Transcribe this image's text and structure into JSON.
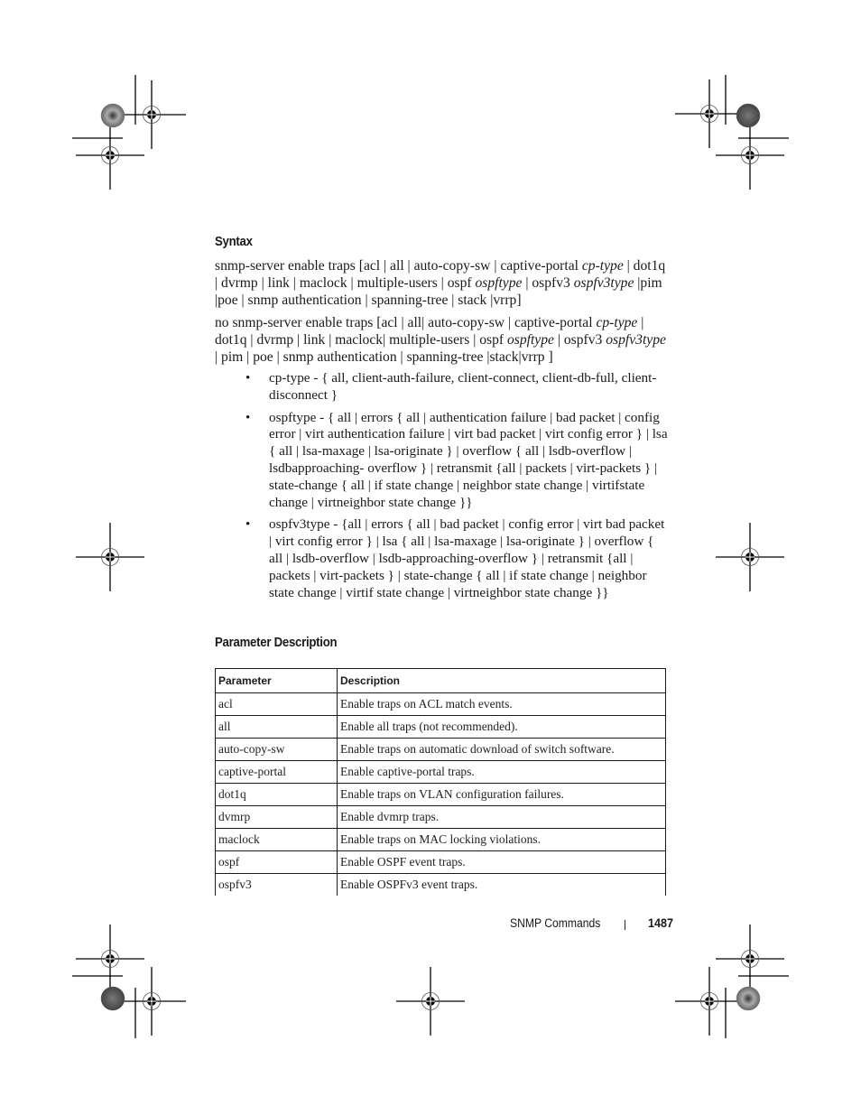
{
  "sections": {
    "syntax_heading": "Syntax",
    "parameter_heading": "Parameter Description"
  },
  "syntax": {
    "command": [
      {
        "text": "snmp-server enable traps [acl | all | auto-copy-sw | captive-portal ",
        "italic": false
      },
      {
        "text": "cp-type",
        "italic": true
      },
      {
        "text": " | dot1q | dvrmp | link | maclock | multiple-users | ospf ",
        "italic": false
      },
      {
        "text": "ospftype",
        "italic": true
      },
      {
        "text": " | ospfv3 ",
        "italic": false
      },
      {
        "text": "ospfv3type",
        "italic": true
      },
      {
        "text": " |pim |poe | snmp authentication | spanning-tree | stack |vrrp]",
        "italic": false
      }
    ],
    "no_command": [
      {
        "text": "no snmp-server enable traps [acl | all| auto-copy-sw | captive-portal ",
        "italic": false
      },
      {
        "text": "cp-type",
        "italic": true
      },
      {
        "text": " | dot1q | dvrmp | link | maclock| multiple-users | ospf ",
        "italic": false
      },
      {
        "text": "ospftype",
        "italic": true
      },
      {
        "text": " | ospfv3 ",
        "italic": false
      },
      {
        "text": "ospfv3type",
        "italic": true
      },
      {
        "text": " | pim | poe | snmp authentication | spanning-tree |stack|vrrp ]",
        "italic": false
      }
    ],
    "bullets": [
      "cp-type - { all, client-auth-failure, client-connect, client-db-full, client-disconnect }",
      "ospftype - { all | errors { all | authentication failure | bad packet | config error | virt authentication failure | virt bad packet | virt config error } | lsa { all | lsa-maxage | lsa-originate } | overflow { all | lsdb-overflow | lsdbapproaching- overflow } | retransmit {all | packets | virt-packets } | state-change { all | if state change | neighbor state change | virtifstate change | virtneighbor state change }}",
      "ospfv3type - {all | errors { all | bad packet | config error | virt bad packet | virt config error } | lsa { all | lsa-maxage | lsa-originate } | overflow { all | lsdb-overflow | lsdb-approaching-overflow } | retransmit {all | packets | virt-packets } | state-change { all | if state change | neighbor state change | virtif state change | virtneighbor state change }}"
    ],
    "bullet_glyph": "•"
  },
  "table": {
    "headers": [
      "Parameter",
      "Description"
    ],
    "rows": [
      [
        "acl",
        "Enable traps on ACL match events."
      ],
      [
        "all",
        "Enable all traps (not recommended)."
      ],
      [
        "auto-copy-sw",
        "Enable traps on automatic download of switch software."
      ],
      [
        "captive-portal",
        "Enable captive-portal traps."
      ],
      [
        "dot1q",
        "Enable traps on VLAN configuration failures."
      ],
      [
        "dvmrp",
        "Enable dvmrp traps."
      ],
      [
        "maclock",
        "Enable traps on MAC locking violations."
      ],
      [
        "ospf",
        "Enable OSPF event traps."
      ],
      [
        "ospfv3",
        "Enable OSPFv3 event traps."
      ]
    ]
  },
  "footer": {
    "chapter": "SNMP Commands",
    "page_number": "1487"
  }
}
